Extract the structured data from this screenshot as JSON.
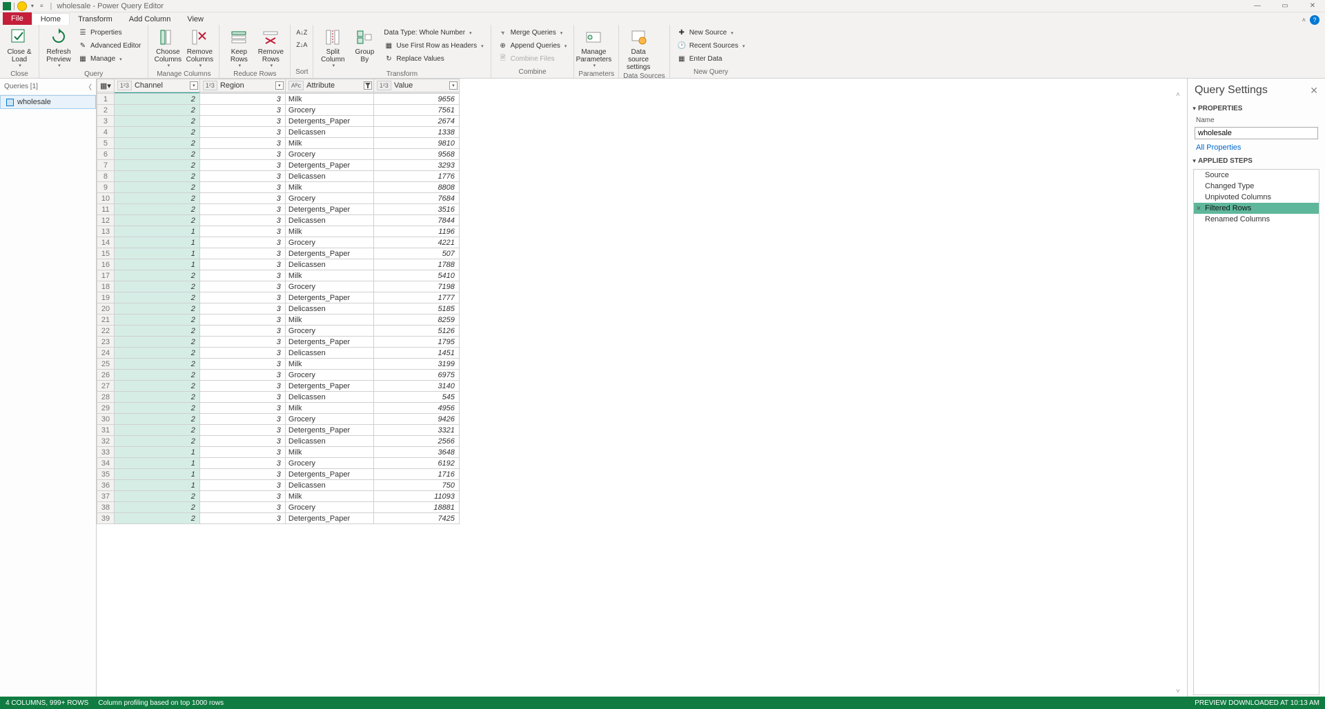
{
  "title": "wholesale - Power Query Editor",
  "tabs": {
    "file": "File",
    "home": "Home",
    "transform": "Transform",
    "addcol": "Add Column",
    "view": "View"
  },
  "ribbon": {
    "close": {
      "close_load": "Close & Load",
      "group": "Close"
    },
    "query": {
      "refresh": "Refresh Preview",
      "properties": "Properties",
      "advanced": "Advanced Editor",
      "manage": "Manage",
      "group": "Query"
    },
    "manage_cols": {
      "choose": "Choose Columns",
      "remove": "Remove Columns",
      "group": "Manage Columns"
    },
    "reduce": {
      "keep": "Keep Rows",
      "remove": "Remove Rows",
      "group": "Reduce Rows"
    },
    "sort": {
      "group": "Sort"
    },
    "transform": {
      "split": "Split Column",
      "groupby": "Group By",
      "datatype": "Data Type: Whole Number",
      "firstrow": "Use First Row as Headers",
      "replace": "Replace Values",
      "group": "Transform"
    },
    "combine": {
      "merge": "Merge Queries",
      "append": "Append Queries",
      "combine_files": "Combine Files",
      "group": "Combine"
    },
    "params": {
      "manage": "Manage Parameters",
      "group": "Parameters"
    },
    "ds": {
      "settings": "Data source settings",
      "group": "Data Sources"
    },
    "new": {
      "new_source": "New Source",
      "recent": "Recent Sources",
      "enter": "Enter Data",
      "group": "New Query"
    }
  },
  "queries_panel": {
    "header": "Queries [1]",
    "item": "wholesale"
  },
  "columns": {
    "c1": "Channel",
    "c2": "Region",
    "c3": "Attribute",
    "c4": "Value"
  },
  "rows": [
    {
      "n": 1,
      "ch": 2,
      "re": 3,
      "at": "Milk",
      "va": 9656
    },
    {
      "n": 2,
      "ch": 2,
      "re": 3,
      "at": "Grocery",
      "va": 7561
    },
    {
      "n": 3,
      "ch": 2,
      "re": 3,
      "at": "Detergents_Paper",
      "va": 2674
    },
    {
      "n": 4,
      "ch": 2,
      "re": 3,
      "at": "Delicassen",
      "va": 1338
    },
    {
      "n": 5,
      "ch": 2,
      "re": 3,
      "at": "Milk",
      "va": 9810
    },
    {
      "n": 6,
      "ch": 2,
      "re": 3,
      "at": "Grocery",
      "va": 9568
    },
    {
      "n": 7,
      "ch": 2,
      "re": 3,
      "at": "Detergents_Paper",
      "va": 3293
    },
    {
      "n": 8,
      "ch": 2,
      "re": 3,
      "at": "Delicassen",
      "va": 1776
    },
    {
      "n": 9,
      "ch": 2,
      "re": 3,
      "at": "Milk",
      "va": 8808
    },
    {
      "n": 10,
      "ch": 2,
      "re": 3,
      "at": "Grocery",
      "va": 7684
    },
    {
      "n": 11,
      "ch": 2,
      "re": 3,
      "at": "Detergents_Paper",
      "va": 3516
    },
    {
      "n": 12,
      "ch": 2,
      "re": 3,
      "at": "Delicassen",
      "va": 7844
    },
    {
      "n": 13,
      "ch": 1,
      "re": 3,
      "at": "Milk",
      "va": 1196
    },
    {
      "n": 14,
      "ch": 1,
      "re": 3,
      "at": "Grocery",
      "va": 4221
    },
    {
      "n": 15,
      "ch": 1,
      "re": 3,
      "at": "Detergents_Paper",
      "va": 507
    },
    {
      "n": 16,
      "ch": 1,
      "re": 3,
      "at": "Delicassen",
      "va": 1788
    },
    {
      "n": 17,
      "ch": 2,
      "re": 3,
      "at": "Milk",
      "va": 5410
    },
    {
      "n": 18,
      "ch": 2,
      "re": 3,
      "at": "Grocery",
      "va": 7198
    },
    {
      "n": 19,
      "ch": 2,
      "re": 3,
      "at": "Detergents_Paper",
      "va": 1777
    },
    {
      "n": 20,
      "ch": 2,
      "re": 3,
      "at": "Delicassen",
      "va": 5185
    },
    {
      "n": 21,
      "ch": 2,
      "re": 3,
      "at": "Milk",
      "va": 8259
    },
    {
      "n": 22,
      "ch": 2,
      "re": 3,
      "at": "Grocery",
      "va": 5126
    },
    {
      "n": 23,
      "ch": 2,
      "re": 3,
      "at": "Detergents_Paper",
      "va": 1795
    },
    {
      "n": 24,
      "ch": 2,
      "re": 3,
      "at": "Delicassen",
      "va": 1451
    },
    {
      "n": 25,
      "ch": 2,
      "re": 3,
      "at": "Milk",
      "va": 3199
    },
    {
      "n": 26,
      "ch": 2,
      "re": 3,
      "at": "Grocery",
      "va": 6975
    },
    {
      "n": 27,
      "ch": 2,
      "re": 3,
      "at": "Detergents_Paper",
      "va": 3140
    },
    {
      "n": 28,
      "ch": 2,
      "re": 3,
      "at": "Delicassen",
      "va": 545
    },
    {
      "n": 29,
      "ch": 2,
      "re": 3,
      "at": "Milk",
      "va": 4956
    },
    {
      "n": 30,
      "ch": 2,
      "re": 3,
      "at": "Grocery",
      "va": 9426
    },
    {
      "n": 31,
      "ch": 2,
      "re": 3,
      "at": "Detergents_Paper",
      "va": 3321
    },
    {
      "n": 32,
      "ch": 2,
      "re": 3,
      "at": "Delicassen",
      "va": 2566
    },
    {
      "n": 33,
      "ch": 1,
      "re": 3,
      "at": "Milk",
      "va": 3648
    },
    {
      "n": 34,
      "ch": 1,
      "re": 3,
      "at": "Grocery",
      "va": 6192
    },
    {
      "n": 35,
      "ch": 1,
      "re": 3,
      "at": "Detergents_Paper",
      "va": 1716
    },
    {
      "n": 36,
      "ch": 1,
      "re": 3,
      "at": "Delicassen",
      "va": 750
    },
    {
      "n": 37,
      "ch": 2,
      "re": 3,
      "at": "Milk",
      "va": 11093
    },
    {
      "n": 38,
      "ch": 2,
      "re": 3,
      "at": "Grocery",
      "va": 18881
    },
    {
      "n": 39,
      "ch": 2,
      "re": 3,
      "at": "Detergents_Paper",
      "va": 7425
    }
  ],
  "settings": {
    "title": "Query Settings",
    "properties": "PROPERTIES",
    "name_label": "Name",
    "name_value": "wholesale",
    "all_props": "All Properties",
    "applied_steps": "APPLIED STEPS",
    "steps": [
      "Source",
      "Changed Type",
      "Unpivoted Columns",
      "Filtered Rows",
      "Renamed Columns"
    ],
    "selected_step_index": 3
  },
  "status": {
    "left1": "4 COLUMNS, 999+ ROWS",
    "left2": "Column profiling based on top 1000 rows",
    "right": "PREVIEW DOWNLOADED AT 10:13 AM"
  },
  "type_labels": {
    "int": "1²3",
    "text": "Aᴮc"
  }
}
